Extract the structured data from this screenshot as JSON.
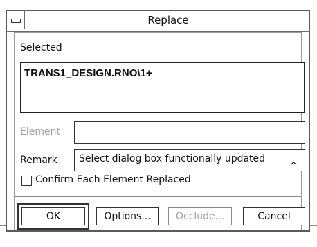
{
  "dialog": {
    "title": "Replace",
    "selected_label": "Selected",
    "selected_items": [
      "TRANS1_DESIGN.RNO\\1+"
    ],
    "element_label": "Element",
    "element_value": "",
    "remark_label": "Remark",
    "remark_value": "Select dialog box functionally updated",
    "confirm_label": "Confirm Each Element Replaced",
    "confirm_checked": false,
    "buttons": {
      "ok": "OK",
      "options": "Options...",
      "occlude": "Occlude...",
      "cancel": "Cancel"
    }
  }
}
